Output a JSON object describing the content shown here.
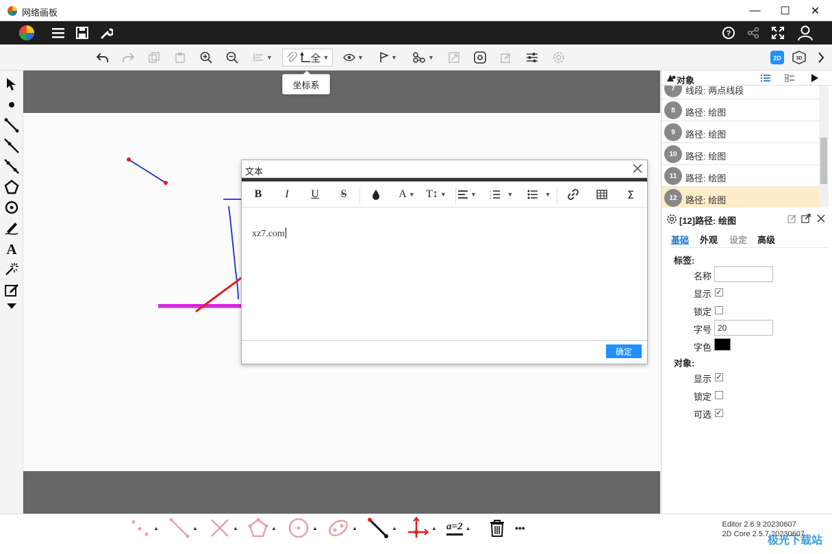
{
  "window": {
    "title": "网络画板",
    "minimize": "—",
    "maximize": "☐",
    "close": "✕"
  },
  "header": {
    "help": "?",
    "share": "share",
    "fullscreen": "fullscreen",
    "user": "user"
  },
  "toolbar": {
    "coord_label": "全",
    "tooltip": "坐标系",
    "mode_2d": "2D",
    "mode_3d": "3D"
  },
  "dialog": {
    "title": "文本",
    "buttons": {
      "bold": "B",
      "italic": "I",
      "underline": "U",
      "strike": "S",
      "color": "◆",
      "font": "A",
      "size": "T↕",
      "table": "⊞",
      "formula": "Σ"
    },
    "content": "xz7.com",
    "ok": "确定"
  },
  "objects_panel": {
    "title": "对象",
    "items": [
      {
        "num": "7",
        "name": "线段: 两点线段"
      },
      {
        "num": "8",
        "name": "路径: 绘图"
      },
      {
        "num": "9",
        "name": "路径: 绘图"
      },
      {
        "num": "10",
        "name": "路径: 绘图"
      },
      {
        "num": "11",
        "name": "路径: 绘图"
      },
      {
        "num": "12",
        "name": "路径: 绘图"
      }
    ]
  },
  "properties": {
    "title": "[12]路径: 绘图",
    "tabs": [
      "基础",
      "外观",
      "设定",
      "高级"
    ],
    "label_section": "标签:",
    "name_label": "名称",
    "name_value": "",
    "show_label": "显示",
    "lock_label": "锁定",
    "fontsize_label": "字号",
    "fontsize_value": "20",
    "color_label": "字色",
    "object_section": "对象:",
    "obj_show_label": "显示",
    "obj_lock_label": "锁定",
    "obj_select_label": "可选",
    "checked": "✓"
  },
  "bottom": {
    "assign_label": "a=2",
    "more": "•••",
    "version_editor": "Editor 2.6.9 20230607",
    "version_core": "2D Core 2.5.7 20230607",
    "watermark": "极光下载站"
  },
  "colors": {
    "accent": "#1e90ff",
    "selected_row": "#fdecc8",
    "header": "#1e1e1e"
  }
}
